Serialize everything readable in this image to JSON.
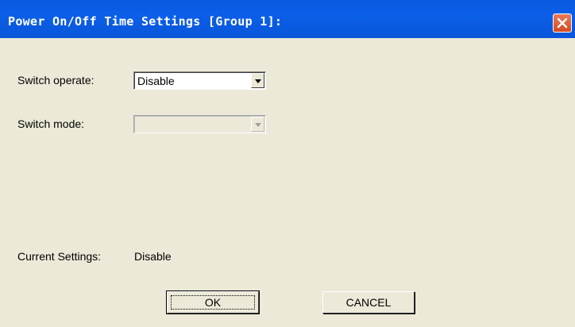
{
  "window": {
    "title": "Power On/Off Time Settings [Group 1]:"
  },
  "form": {
    "switch_operate": {
      "label": "Switch operate:",
      "selected": "Disable",
      "enabled": true
    },
    "switch_mode": {
      "label": "Switch mode:",
      "selected": "",
      "enabled": false
    },
    "current_settings": {
      "label": "Current Settings:",
      "value": "Disable"
    }
  },
  "buttons": {
    "ok_label": "OK",
    "cancel_label": "CANCEL"
  },
  "colors": {
    "titlebar": "#0a58e0",
    "dialog_bg": "#ece9d8",
    "close_button": "#d24a22"
  }
}
